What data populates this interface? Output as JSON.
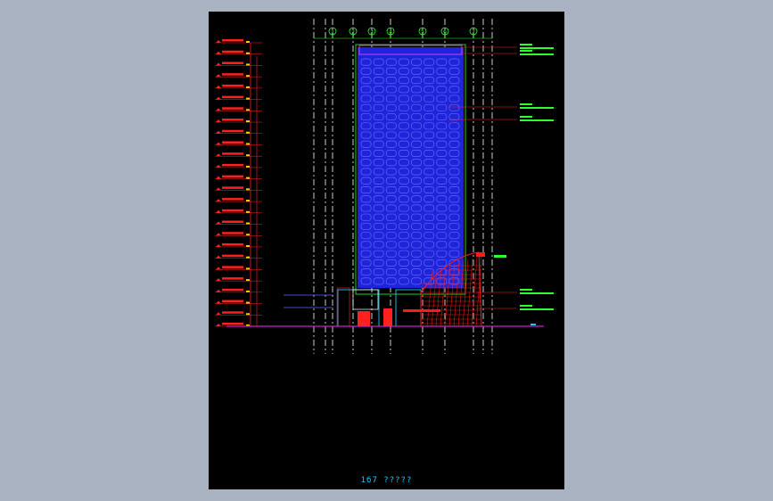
{
  "viewer": {
    "background_color": "#a9b2c0",
    "sheet_color": "#000000"
  },
  "drawing": {
    "caption": "1б7 ?????",
    "grid_labels": [
      "1",
      "2",
      "3",
      "4",
      "5",
      "6",
      "7"
    ],
    "colors": {
      "facade": "#1f24d8",
      "window_outline": "#5f67ff",
      "grid_line": "#ffffff",
      "dimension": "#ff2020",
      "annotation": "#2cff2c",
      "ground": "#d020d0",
      "podium": "#19c8ff",
      "feature": "#ff1a1a"
    },
    "level_count": 26,
    "facade_rows": 25,
    "facade_cols": 8
  }
}
